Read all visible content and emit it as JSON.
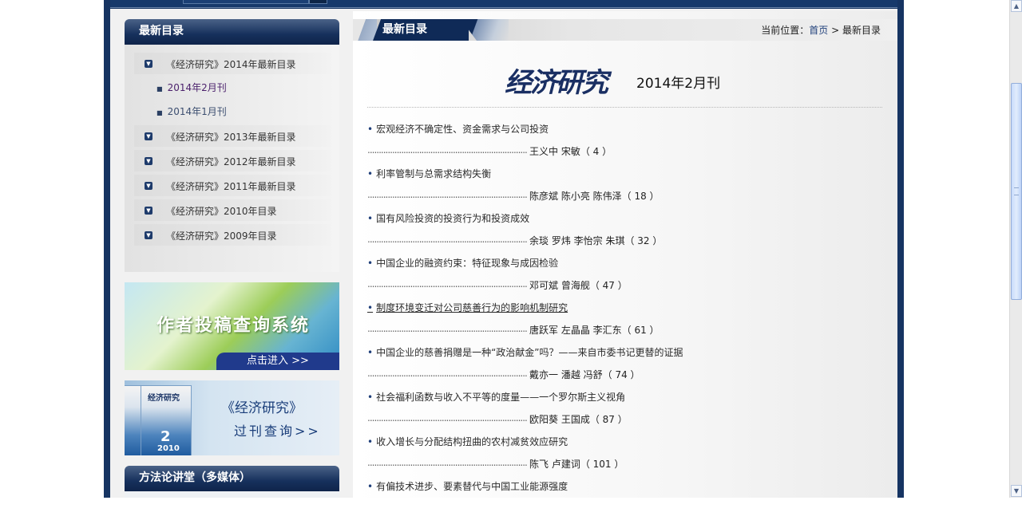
{
  "sidebar": {
    "heading": "最新目录",
    "categories": [
      {
        "label": "《经济研究》2014年最新目录"
      },
      {
        "label": "《经济研究》2013年最新目录"
      },
      {
        "label": "《经济研究》2012年最新目录"
      },
      {
        "label": "《经济研究》2011年最新目录"
      },
      {
        "label": "《经济研究》2010年目录"
      },
      {
        "label": "《经济研究》2009年目录"
      }
    ],
    "sub_items": [
      {
        "label": "2014年2月刊"
      },
      {
        "label": "2014年1月刊"
      }
    ],
    "banner1": {
      "title": "作者投稿查询系统",
      "button": "点击进入 >>"
    },
    "banner2": {
      "book_title": "经济研究",
      "book_number": "2",
      "book_year": "2010",
      "title": "《经济研究》",
      "subtitle": "过刊查询>>"
    },
    "heading2": "方法论讲堂（多媒体）"
  },
  "main": {
    "tab_label": "最新目录",
    "breadcrumb": {
      "prefix": "当前位置：",
      "home": "首页",
      "separator": ">",
      "current": "最新目录"
    },
    "logo_text": "经济研究",
    "issue_title": "2014年2月刊",
    "articles": [
      {
        "title": "宏观经济不确定性、资金需求与公司投资",
        "authors": "王义中 宋敏（ 4 ）"
      },
      {
        "title": "利率管制与总需求结构失衡",
        "authors": "陈彦斌 陈小亮 陈伟泽（ 18 ）"
      },
      {
        "title": "国有风险投资的投资行为和投资成效",
        "authors": "余琰 罗炜 李怡宗 朱琪（ 32 ）"
      },
      {
        "title": "中国企业的融资约束：特征现象与成因检验",
        "authors": "邓可斌 曾海舰（ 47 ）"
      },
      {
        "title": "制度环境变迁对公司慈善行为的影响机制研究",
        "authors": "唐跃军 左晶晶 李汇东（ 61 ）"
      },
      {
        "title": "中国企业的慈善捐赠是一种“政治献金”吗？——来自市委书记更替的证据",
        "authors": "戴亦一 潘越 冯舒（ 74 ）"
      },
      {
        "title": "社会福利函数与收入不平等的度量——一个罗尔斯主义视角",
        "authors": "欧阳葵 王国成（ 87 ）"
      },
      {
        "title": "收入增长与分配结构扭曲的农村减贫效应研究",
        "authors": "陈飞 卢建词（ 101 ）"
      },
      {
        "title": "有偏技术进步、要素替代与中国工业能源强度",
        "authors": ""
      }
    ],
    "dots": "................................................................................................................................"
  },
  "icons": {
    "bullet": "•",
    "category_toggle": "chevron-down-icon",
    "sub_bullet": "▪"
  }
}
